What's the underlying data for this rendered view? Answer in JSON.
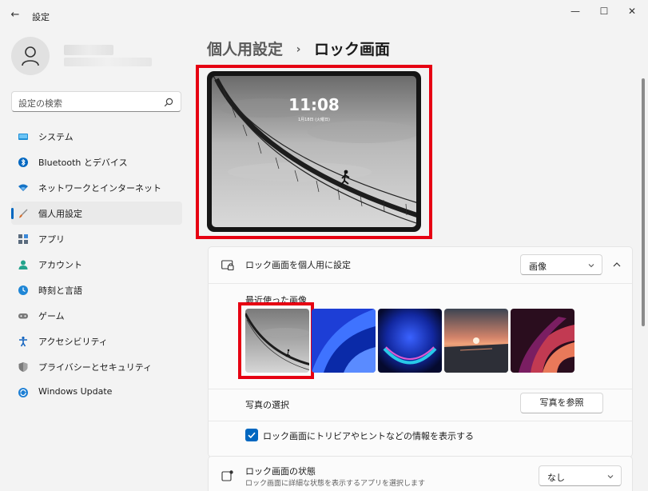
{
  "window": {
    "title": "設定",
    "back_glyph": "←",
    "minimize_glyph": "—",
    "maximize_glyph": "☐",
    "close_glyph": "✕"
  },
  "search": {
    "placeholder": "設定の検索"
  },
  "nav": {
    "items": [
      {
        "label": "システム",
        "icon": "system-icon",
        "color": "#1f8fd6"
      },
      {
        "label": "Bluetooth とデバイス",
        "icon": "bluetooth-icon",
        "color": "#0067c0"
      },
      {
        "label": "ネットワークとインターネット",
        "icon": "network-icon",
        "color": "#1573c6"
      },
      {
        "label": "個人用設定",
        "icon": "personalization-icon",
        "color": "#d26b2b",
        "active": true
      },
      {
        "label": "アプリ",
        "icon": "apps-icon",
        "color": "#5a6b7d"
      },
      {
        "label": "アカウント",
        "icon": "accounts-icon",
        "color": "#23a38c"
      },
      {
        "label": "時刻と言語",
        "icon": "time-language-icon",
        "color": "#1f86d6"
      },
      {
        "label": "ゲーム",
        "icon": "gaming-icon",
        "color": "#7a7a7a"
      },
      {
        "label": "アクセシビリティ",
        "icon": "accessibility-icon",
        "color": "#1565c0"
      },
      {
        "label": "プライバシーとセキュリティ",
        "icon": "privacy-shield-icon",
        "color": "#7b7b7b"
      },
      {
        "label": "Windows Update",
        "icon": "windows-update-icon",
        "color": "#1d7fd4"
      }
    ]
  },
  "breadcrumb": {
    "parent": "個人用設定",
    "separator": "›",
    "current": "ロック画面"
  },
  "preview": {
    "time": "11:08",
    "date": "1月18日 (火曜日)"
  },
  "personalize": {
    "label": "ロック画面を個人用に設定",
    "value": "画像",
    "recent_label": "最近使った画像",
    "photo_select_label": "写真の選択",
    "browse_label": "写真を参照",
    "trivia_label": "ロック画面にトリビアやヒントなどの情報を表示する",
    "trivia_checked": true
  },
  "status": {
    "label": "ロック画面の状態",
    "sub": "ロック画面に詳細な状態を表示するアプリを選択します",
    "value": "なし"
  },
  "colors": {
    "accent": "#0067c0",
    "highlight_box": "#e60012"
  }
}
